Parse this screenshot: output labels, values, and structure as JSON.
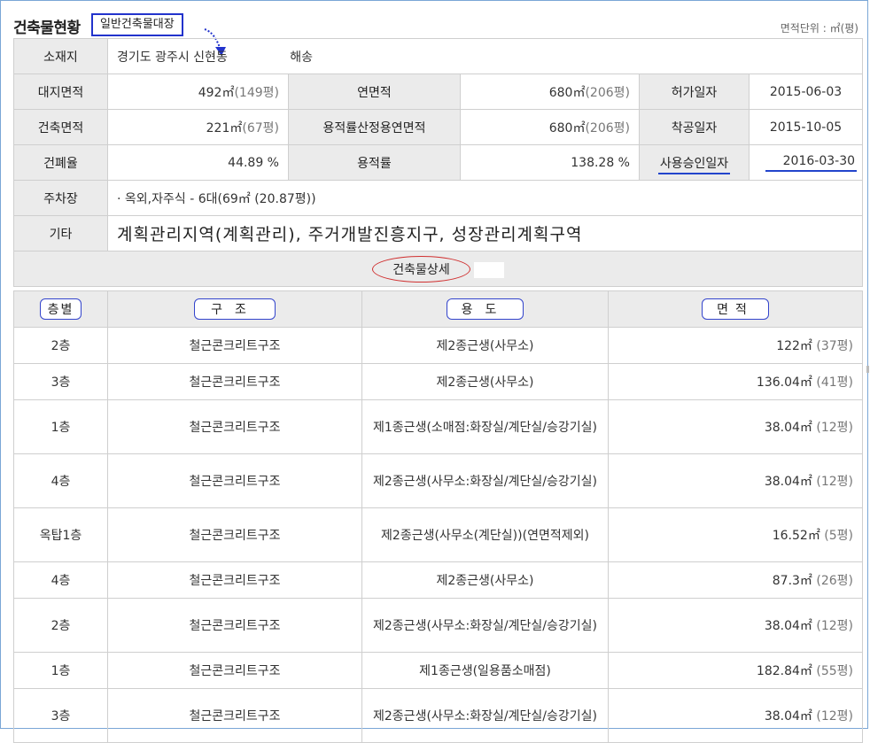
{
  "header": {
    "title": "건축물현황",
    "subtitle": "일반건축물대장",
    "unit": "면적단위 : ㎡(평)"
  },
  "info": {
    "location_label": "소재지",
    "location_value": "경기도 광주시 신현동",
    "location_value2": "해송",
    "land_area_label": "대지면적",
    "land_area_value": "492㎡",
    "land_area_pyeong": "(149평)",
    "gross_area_label": "연면적",
    "gross_area_value": "680㎡",
    "gross_area_pyeong": "(206평)",
    "permit_date_label": "허가일자",
    "permit_date_value": "2015-06-03",
    "building_area_label": "건축면적",
    "building_area_value": "221㎡",
    "building_area_pyeong": "(67평)",
    "far_area_label": "용적률산정용연면적",
    "far_area_value": "680㎡",
    "far_area_pyeong": "(206평)",
    "start_date_label": "착공일자",
    "start_date_value": "2015-10-05",
    "coverage_label": "건폐율",
    "coverage_value": "44.89 %",
    "far_label": "용적률",
    "far_value": "138.28 %",
    "approval_date_label": "사용승인일자",
    "approval_date_value": "2016-03-30",
    "parking_label": "주차장",
    "parking_value": "· 옥외,자주식 - 6대(69㎡ (20.87평))",
    "other_label": "기타",
    "other_value": "계획관리지역(계획관리), 주거개발진흥지구, 성장관리계획구역"
  },
  "detail": {
    "section_title": "건축물상세",
    "headers": {
      "floor": "층별",
      "structure": "구조",
      "usage": "용도",
      "area": "면적"
    },
    "rows": [
      {
        "floor": "2층",
        "structure": "철근콘크리트구조",
        "usage": "제2종근생(사무소)",
        "area": "122㎡",
        "pyeong": "(37평)"
      },
      {
        "floor": "3층",
        "structure": "철근콘크리트구조",
        "usage": "제2종근생(사무소)",
        "area": "136.04㎡",
        "pyeong": "(41평)"
      },
      {
        "floor": "1층",
        "structure": "철근콘크리트구조",
        "usage": "제1종근생(소매점:화장실/계단실/승강기실)",
        "area": "38.04㎡",
        "pyeong": "(12평)"
      },
      {
        "floor": "4층",
        "structure": "철근콘크리트구조",
        "usage": "제2종근생(사무소:화장실/계단실/승강기실)",
        "area": "38.04㎡",
        "pyeong": "(12평)"
      },
      {
        "floor": "옥탑1층",
        "structure": "철근콘크리트구조",
        "usage": "제2종근생(사무소(계단실))(연면적제외)",
        "area": "16.52㎡",
        "pyeong": "(5평)"
      },
      {
        "floor": "4층",
        "structure": "철근콘크리트구조",
        "usage": "제2종근생(사무소)",
        "area": "87.3㎡",
        "pyeong": "(26평)"
      },
      {
        "floor": "2층",
        "structure": "철근콘크리트구조",
        "usage": "제2종근생(사무소:화장실/계단실/승강기실)",
        "area": "38.04㎡",
        "pyeong": "(12평)"
      },
      {
        "floor": "1층",
        "structure": "철근콘크리트구조",
        "usage": "제1종근생(일용품소매점)",
        "area": "182.84㎡",
        "pyeong": "(55평)"
      },
      {
        "floor": "3층",
        "structure": "철근콘크리트구조",
        "usage": "제2종근생(사무소:화장실/계단실/승강기실)",
        "area": "38.04㎡",
        "pyeong": "(12평)"
      }
    ]
  },
  "colors": {
    "label_bg": "#ebebeb",
    "border": "#cfcfcf",
    "annotation_blue": "#2233cc",
    "annotation_red": "#d03030"
  }
}
